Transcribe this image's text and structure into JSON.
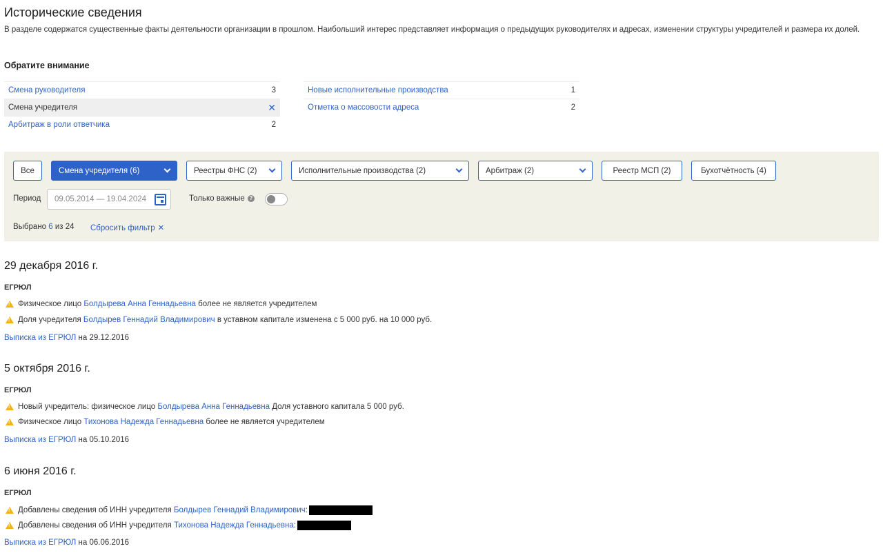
{
  "header": {
    "title": "Исторические сведения",
    "intro": "В разделе содержатся существенные факты деятельности организации в прошлом. Наибольший интерес представляет информация о предыдущих руководителях и адресах, изменении структуры учредителей и размера их долей."
  },
  "attention": {
    "title": "Обратите внимание",
    "left": [
      {
        "label": "Смена руководителя",
        "count": "3"
      },
      {
        "label": "Смена учредителя",
        "count": "✕"
      },
      {
        "label": "Арбитраж в роли ответчика",
        "count": "2"
      }
    ],
    "right": [
      {
        "label": "Новые исполнительные производства",
        "count": "1"
      },
      {
        "label": "Отметка о массовости адреса",
        "count": "2"
      }
    ]
  },
  "filters": {
    "buttons": [
      {
        "label": "Все"
      },
      {
        "label": "Смена учредителя (6)"
      },
      {
        "label": "Реестры ФНС (2)"
      },
      {
        "label": "Исполнительные производства (2)"
      },
      {
        "label": "Арбитраж (2)"
      },
      {
        "label": "Реестр МСП (2)"
      },
      {
        "label": "Бухотчётность (4)"
      }
    ],
    "period_label": "Период",
    "period_value": "09.05.2014 — 19.04.2024",
    "important_label": "Только важные",
    "help_glyph": "?",
    "selected_prefix": "Выбрано",
    "selected_count": "6",
    "selected_suffix": "из 24",
    "reset_label": "Сбросить фильтр",
    "reset_glyph": "✕"
  },
  "events": [
    {
      "date": "29 декабря 2016 г.",
      "source": "ЕГРЮЛ",
      "lines": [
        {
          "pre": "Физическое лицо",
          "link": "Болдырева Анна Геннадьевна",
          "post": "более не является учредителем"
        },
        {
          "pre": "Доля учредителя",
          "link": "Болдырев Геннадий Владимирович",
          "post": "в уставном капитале изменена с 5 000 руб. на 10 000 руб."
        }
      ],
      "extract_link": "Выписка из ЕГРЮЛ",
      "extract_post": "на 29.12.2016"
    },
    {
      "date": "5 октября 2016 г.",
      "source": "ЕГРЮЛ",
      "lines": [
        {
          "pre": "Новый учредитель: физическое лицо",
          "link": "Болдырева Анна Геннадьевна",
          "post": "Доля уставного капитала 5 000 руб."
        },
        {
          "pre": "Физическое лицо",
          "link": "Тихонова Надежда Геннадьевна",
          "post": "более не является учредителем"
        }
      ],
      "extract_link": "Выписка из ЕГРЮЛ",
      "extract_post": "на 05.10.2016"
    },
    {
      "date": "6 июня 2016 г.",
      "source": "ЕГРЮЛ",
      "lines": [
        {
          "pre": "Добавлены сведения об ИНН учредителя",
          "link": "Болдырев Геннадий Владимирович",
          "post": ":"
        },
        {
          "pre": "Добавлены сведения об ИНН учредителя",
          "link": "Тихонова Надежда Геннадьевна",
          "post": ":"
        }
      ],
      "extract_link": "Выписка из ЕГРЮЛ",
      "extract_post": "на 06.06.2016"
    }
  ],
  "colors": {
    "accent": "#2f62c9",
    "panel": "#f1f1e8",
    "warning": "#f2b21b"
  }
}
